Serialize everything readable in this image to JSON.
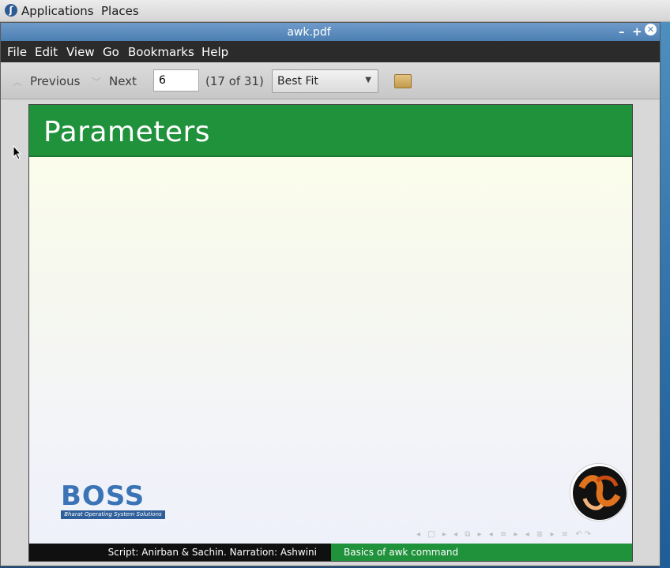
{
  "panel": {
    "applications": "Applications",
    "places": "Places"
  },
  "window": {
    "title": "awk.pdf",
    "minimize": "–",
    "maximize": "+",
    "close": "✕"
  },
  "menubar": {
    "items": [
      "File",
      "Edit",
      "View",
      "Go",
      "Bookmarks",
      "Help"
    ]
  },
  "toolbar": {
    "previous": "Previous",
    "next": "Next",
    "page_value": "6",
    "page_count": "(17 of 31)",
    "zoom": "Best Fit"
  },
  "slide": {
    "title": "Parameters",
    "footer_left": "Script: Anirban & Sachin. Narration: Ashwini",
    "footer_right": "Basics of awk command",
    "boss_logo_text": "BOSS",
    "boss_logo_sub": "Bharat Operating System Solutions"
  },
  "colors": {
    "slide_header": "#21923c",
    "menubar": "#2b2b2b",
    "titlebar": "#4c7fb3"
  }
}
